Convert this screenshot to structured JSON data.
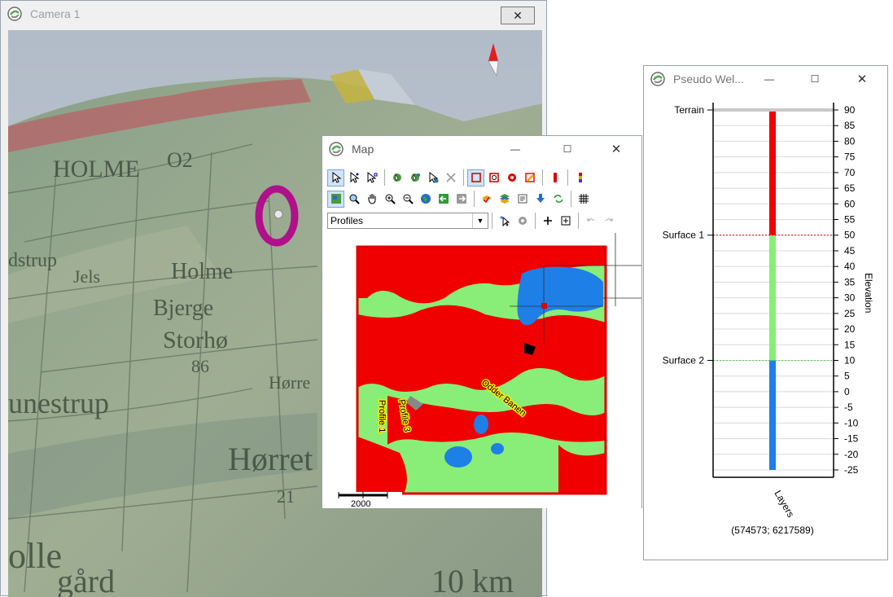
{
  "camera": {
    "title": "Camera 1",
    "close_glyph": "✕",
    "place_names": [
      "HOLME",
      "O2",
      "dstrup",
      "Jels",
      "Holme",
      "Bjerge",
      "Storhø",
      "86",
      "Hørre",
      "unestrup",
      "Hørret",
      "21",
      "olle",
      "gård",
      "10 km"
    ],
    "icons": [
      "app-logo-icon",
      "close-icon",
      "north-arrow-icon"
    ]
  },
  "map": {
    "title": "Map",
    "minimize_glyph": "—",
    "maximize_glyph": "☐",
    "close_glyph": "✕",
    "layer_select": {
      "value": "Profiles"
    },
    "labels": {
      "road": "Odder Banen",
      "profile_1": "Profile 1",
      "profile_3": "Profile 3",
      "scale": "2000"
    },
    "toolbar_icons": [
      "select-arrow-icon",
      "select-node-icon",
      "select-multi-icon",
      "pan-select-icon",
      "zoom-select-icon",
      "identify-icon",
      "delete-icon",
      "rect-red-icon",
      "rect-zoom-icon",
      "gear-red-icon",
      "edit-icon",
      "red-bar-icon",
      "well-bar-icon",
      "zoom-extent-icon",
      "zoom-window-icon",
      "pan-hand-icon",
      "zoom-in-icon",
      "zoom-out-icon",
      "globe-icon",
      "back-icon",
      "forward-icon",
      "layers-add-icon",
      "layers-icon",
      "properties-icon",
      "download-icon",
      "refresh-icon",
      "grid-icon",
      "cursor-plus-icon",
      "gear-gray-icon",
      "crosshair-icon",
      "target-icon",
      "undo-icon",
      "redo-icon"
    ]
  },
  "well": {
    "title": "Pseudo Wel...",
    "minimize_glyph": "—",
    "maximize_glyph": "☐",
    "close_glyph": "✕",
    "surface_labels": [
      {
        "name": "Terrain",
        "elevation": 90
      },
      {
        "name": "Surface 1",
        "elevation": 50
      },
      {
        "name": "Surface 2",
        "elevation": 10
      }
    ],
    "axis_label": "Elevation",
    "x_label": "Layers",
    "coordinates": "(574573; 6217589)",
    "ticks": [
      "90",
      "85",
      "80",
      "75",
      "70",
      "65",
      "60",
      "55",
      "50",
      "45",
      "40",
      "35",
      "30",
      "25",
      "20",
      "15",
      "10",
      "5",
      "0",
      "-5",
      "-10",
      "-15",
      "-20",
      "-25"
    ],
    "colors": {
      "top": "#f00000",
      "middle": "#88ee77",
      "bottom": "#1e7fe6"
    }
  }
}
